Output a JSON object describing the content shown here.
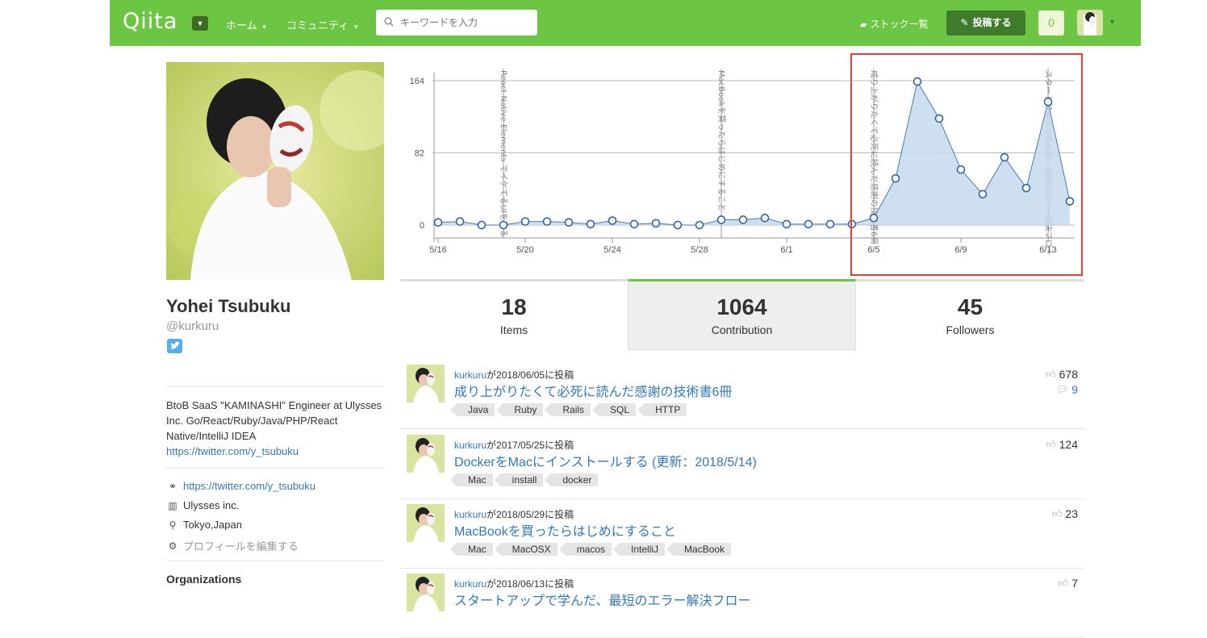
{
  "header": {
    "logo": "Qiita",
    "nav": [
      "ホーム",
      "コミュニティ"
    ],
    "search_placeholder": "キーワードを入力",
    "stock_label": "ストック一覧",
    "post_label": "投稿する",
    "notifications": "0",
    "colors": {
      "bar": "#6cc644",
      "post_button": "#3f7b2d"
    }
  },
  "profile": {
    "name": "Yohei Tsubuku",
    "handle": "@kurkuru",
    "bio_text": "BtoB SaaS \"KAMINASHI\" Engineer at Ulysses Inc. Go/React/Ruby/Java/PHP/React Native/IntelliJ IDEA",
    "bio_link": "https://twitter.com/y_tsubuku",
    "website": "https://twitter.com/y_tsubuku",
    "organization": "Ulysses inc.",
    "location": "Tokyo,Japan",
    "edit_label": "プロフィールを編集する",
    "organizations_title": "Organizations"
  },
  "chart_data": {
    "type": "area",
    "y_ticks": [
      0,
      82,
      164
    ],
    "ylim": [
      0,
      164
    ],
    "x_tick_labels": [
      "5/16",
      "5/20",
      "5/24",
      "5/28",
      "6/1",
      "6/5",
      "6/9",
      "6/13"
    ],
    "x": [
      "5/16",
      "5/17",
      "5/18",
      "5/19",
      "5/20",
      "5/21",
      "5/22",
      "5/23",
      "5/24",
      "5/25",
      "5/26",
      "5/27",
      "5/28",
      "5/29",
      "5/30",
      "5/31",
      "6/1",
      "6/2",
      "6/3",
      "6/4",
      "6/5",
      "6/6",
      "6/7",
      "6/8",
      "6/9",
      "6/10",
      "6/11",
      "6/12",
      "6/13",
      "6/14"
    ],
    "values": [
      3,
      4,
      0,
      0,
      4,
      4,
      3,
      1,
      5,
      1,
      2,
      0,
      0,
      6,
      6,
      8,
      1,
      1,
      1,
      1,
      8,
      53,
      163,
      121,
      63,
      35,
      77,
      42,
      140,
      27
    ],
    "annotations": [
      {
        "x": "5/19",
        "text": "React Native Elements でイケてるUIを作る"
      },
      {
        "x": "5/29",
        "text": "MacBookを買ったらはじめにすること"
      },
      {
        "x": "6/5",
        "text": "成り上がりたくて必死に読んだ感謝の技術書6冊"
      },
      {
        "x": "6/13",
        "text": "スタートアップで学んだ、最短のエラー解決フロー"
      }
    ],
    "grid": true,
    "colors": {
      "line": "#4a7bb0",
      "fill": "#c6d9ec",
      "highlight": "#e0413a"
    }
  },
  "stats": [
    {
      "num": "18",
      "label": "Items"
    },
    {
      "num": "1064",
      "label": "Contribution"
    },
    {
      "num": "45",
      "label": "Followers"
    }
  ],
  "feed": [
    {
      "user": "kurkuru",
      "meta": "が2018/06/05に投稿",
      "title": "成り上がりたくて必死に読んだ感謝の技術書6冊",
      "tags": [
        "Java",
        "Ruby",
        "Rails",
        "SQL",
        "HTTP"
      ],
      "likes": "678",
      "comments": "9"
    },
    {
      "user": "kurkuru",
      "meta": "が2017/05/25に投稿",
      "title": "DockerをMacにインストールする (更新：2018/5/14)",
      "tags": [
        "Mac",
        "install",
        "docker"
      ],
      "likes": "124"
    },
    {
      "user": "kurkuru",
      "meta": "が2018/05/29に投稿",
      "title": "MacBookを買ったらはじめにすること",
      "tags": [
        "Mac",
        "MacOSX",
        "macos",
        "IntelliJ",
        "MacBook"
      ],
      "likes": "23"
    },
    {
      "user": "kurkuru",
      "meta": "が2018/06/13に投稿",
      "title": "スタートアップで学んだ、最短のエラー解決フロー",
      "tags": [],
      "likes": "7"
    }
  ]
}
